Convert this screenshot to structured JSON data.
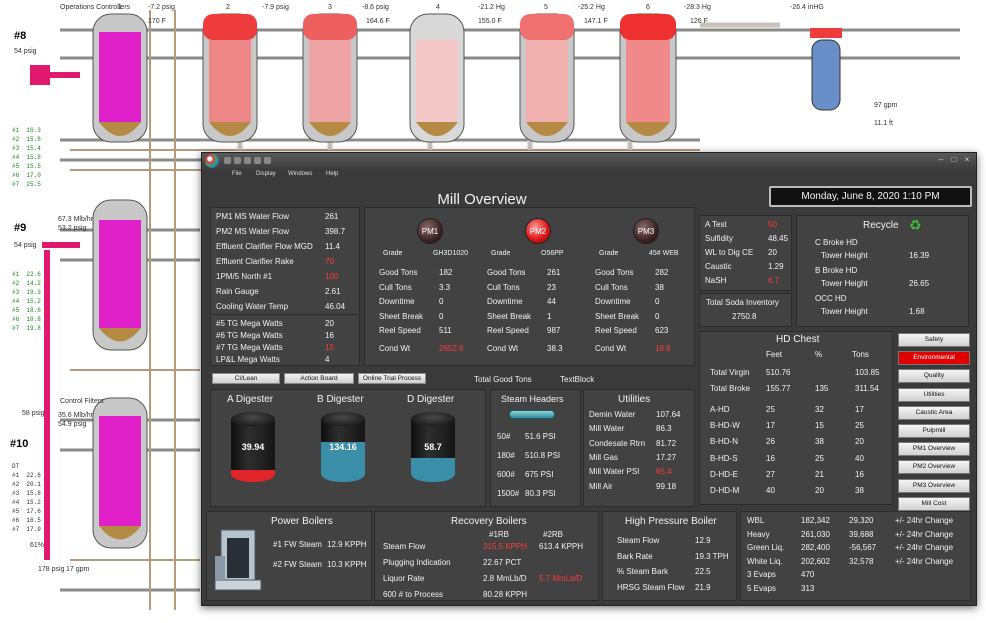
{
  "background": {
    "line_labels": [
      "#8",
      "#9",
      "#10"
    ],
    "top_readings": [
      "-7.2 psig",
      "-7.9 psig",
      "-8.6 psig",
      "-21.2 Hg",
      "-25.2 Hg",
      "-28.3 Hg",
      "-26.4 inHG"
    ],
    "top_temps": [
      "1",
      "2",
      "3",
      "4",
      "5",
      "6",
      "7"
    ],
    "misc": [
      "170 F",
      "164.6 F",
      "155.0 F",
      "147.1 F",
      "126 F",
      "97 gpm",
      "11.1 ft",
      "54 psig",
      "58 psig",
      "61%",
      "17 gpm",
      "178 psig",
      "35.6 Mlb/hr",
      "54.9 psig",
      "67.3 Mlb/hr",
      "53.2 psig",
      "Operations Controllers",
      "Control Filters"
    ],
    "stats": "#1  16.3\n#2  15.8\n#3  15.4\n#4  15.8\n#5  15.5\n#6  17.0\n#7  25.5",
    "stats2": "#1  22.6\n#2  14.2\n#3  19.3\n#4  15.2\n#5  18.6\n#6  18.8\n#7  19.8",
    "stats3": "DT\n#1  22.6\n#2  20.1\n#3  15.8\n#4  15.2\n#5  17.6\n#6  16.5\n#7  17.9"
  },
  "window": {
    "menu": [
      "File",
      "Display",
      "Windows",
      "Help"
    ],
    "title": "Mill Overview",
    "datetime": "Monday, June 8, 2020 1:10 PM"
  },
  "water": [
    {
      "label": "PM1 MS Water Flow",
      "value": "261",
      "alarm": false
    },
    {
      "label": "PM2 MS Water Flow",
      "value": "398.7",
      "alarm": false
    },
    {
      "label": "Effluent Clarifier Flow MGD",
      "value": "11.4",
      "alarm": false
    },
    {
      "label": "Effluent Clarifier Rake",
      "value": "70",
      "alarm": true
    },
    {
      "label": "1PM/5 North #1",
      "value": "100",
      "alarm": true
    },
    {
      "label": "Rain Gauge",
      "value": "2.61",
      "alarm": false
    },
    {
      "label": "Cooling Water Temp",
      "value": "46.04",
      "alarm": false
    }
  ],
  "power": [
    {
      "label": "#5 TG Mega Watts",
      "value": "20",
      "alarm": false
    },
    {
      "label": "#6 TG Mega Watts",
      "value": "16",
      "alarm": false
    },
    {
      "label": "#7 TG Mega Watts",
      "value": "15",
      "alarm": true
    },
    {
      "label": "LP&L Mega Watts",
      "value": "4",
      "alarm": false
    }
  ],
  "pm": [
    {
      "name": "PM1",
      "grade_label": "Grade",
      "grade": "GH3D1020",
      "good": "182",
      "cull": "3.3",
      "downtime": "0",
      "sheet_break": "0",
      "reel_speed": "511",
      "cond_wt": "2652.6",
      "cond_alarm": true
    },
    {
      "name": "PM2",
      "grade_label": "Grade",
      "grade": "O56PP",
      "good": "261",
      "cull": "23",
      "downtime": "44",
      "sheet_break": "1",
      "reel_speed": "987",
      "cond_wt": "38.3",
      "cond_alarm": false
    },
    {
      "name": "PM3",
      "grade_label": "Grade",
      "grade": "45# WEB",
      "good": "282",
      "cull": "38",
      "downtime": "0",
      "sheet_break": "0",
      "reel_speed": "623",
      "cond_wt": "18.8",
      "cond_alarm": true
    }
  ],
  "pm_labels": {
    "good": "Good Tons",
    "cull": "Cull Tons",
    "downtime": "Downtime",
    "sheet_break": "Sheet Break",
    "reel_speed": "Reel Speed",
    "cond_wt": "Cond Wt"
  },
  "chem": [
    {
      "label": "A Test",
      "value": "50",
      "alarm": true
    },
    {
      "label": "Sulfidity",
      "value": "48.45",
      "alarm": false
    },
    {
      "label": "WL to Dig CE",
      "value": "20",
      "alarm": false
    },
    {
      "label": "Caustic",
      "value": "1.29",
      "alarm": false
    },
    {
      "label": "NaSH",
      "value": "6.7",
      "alarm": true
    }
  ],
  "soda": {
    "label": "Total Soda Inventory",
    "value": "2750.8"
  },
  "recycle": {
    "title": "Recycle",
    "items": [
      {
        "name": "C Broke HD",
        "sub": "Tower Height",
        "value": "16.39"
      },
      {
        "name": "B Broke HD",
        "sub": "Tower Height",
        "value": "26.65"
      },
      {
        "name": "OCC HD",
        "sub": "Tower Height",
        "value": "1.68"
      }
    ]
  },
  "hd_chest": {
    "title": "HD Chest",
    "cols": [
      "Feet",
      "%",
      "Tons"
    ],
    "rows": [
      {
        "name": "Total Virgin",
        "feet": "510.76",
        "pct": "",
        "tons": "103.85"
      },
      {
        "name": "Total Broke",
        "feet": "155.77",
        "pct": "135",
        "tons": "311.54"
      },
      {
        "name": "A-HD",
        "feet": "25",
        "pct": "32",
        "tons": "17"
      },
      {
        "name": "B-HD-W",
        "feet": "17",
        "pct": "15",
        "tons": "25"
      },
      {
        "name": "B-HD-N",
        "feet": "26",
        "pct": "38",
        "tons": "20"
      },
      {
        "name": "B-HD-S",
        "feet": "16",
        "pct": "25",
        "tons": "40"
      },
      {
        "name": "D-HD-E",
        "feet": "27",
        "pct": "21",
        "tons": "16"
      },
      {
        "name": "D-HD-M",
        "feet": "40",
        "pct": "20",
        "tons": "38"
      }
    ]
  },
  "nav_buttons": [
    {
      "label": "Safety",
      "active": false
    },
    {
      "label": "Environmental",
      "active": true
    },
    {
      "label": "Quality",
      "active": false
    },
    {
      "label": "Utilities",
      "active": false
    },
    {
      "label": "Caustic Area",
      "active": false
    },
    {
      "label": "Pulpmill",
      "active": false
    },
    {
      "label": "PM1 Overview",
      "active": false
    },
    {
      "label": "PM2 Overview",
      "active": false
    },
    {
      "label": "PM3 Overview",
      "active": false
    },
    {
      "label": "Mill Cost",
      "active": false
    }
  ],
  "toolbar": {
    "btn1": "CI/Lean",
    "btn2": "Action Board",
    "btn3": "Online Trial Process",
    "total_good": "Total Good Tons",
    "textblock": "TextBlock"
  },
  "digesters": [
    {
      "name": "A Digester",
      "value": "39.94",
      "level": 0.18,
      "color": "#e0262b"
    },
    {
      "name": "B Digester",
      "value": "134.16",
      "level": 0.62,
      "color": "#3a8ea8"
    },
    {
      "name": "D Digester",
      "value": "58.7",
      "level": 0.38,
      "color": "#3a8ea8"
    }
  ],
  "steam": {
    "title": "Steam Headers",
    "rows": [
      {
        "label": "50#",
        "value": "51.6 PSI"
      },
      {
        "label": "180#",
        "value": "510.8 PSI"
      },
      {
        "label": "600#",
        "value": "675 PSI"
      },
      {
        "label": "1500#",
        "value": "80.3 PSI"
      }
    ]
  },
  "utilities": {
    "title": "Utilities",
    "rows": [
      {
        "label": "Demin Water",
        "value": "107.64",
        "alarm": false
      },
      {
        "label": "Mill Water",
        "value": "86.3",
        "alarm": false
      },
      {
        "label": "Condesate Rtrn",
        "value": "81.72",
        "alarm": false
      },
      {
        "label": "Mill Gas",
        "value": "17.27",
        "alarm": false
      },
      {
        "label": "Mill Water PSI",
        "value": "65.4",
        "alarm": true
      },
      {
        "label": "Mill Air",
        "value": "99.18",
        "alarm": false
      }
    ]
  },
  "power_boilers": {
    "title": "Power Boilers",
    "rows": [
      {
        "label": "#1 FW Steam",
        "value": "12.9 KPPH"
      },
      {
        "label": "#2 FW Steam",
        "value": "10.3 KPPH"
      }
    ]
  },
  "recovery": {
    "title": "Recovery Boilers",
    "col1": "#1RB",
    "col2": "#2RB",
    "rows": [
      {
        "label": "Steam Flow",
        "v1": "315.5 KPPH",
        "v1_alarm": true,
        "v2": "613.4 KPPH",
        "v2_alarm": false
      },
      {
        "label": "Plugging Indication",
        "v1": "22.67 PCT",
        "v1_alarm": false,
        "v2": "",
        "v2_alarm": false
      },
      {
        "label": "Liquor Rate",
        "v1": "2.8 MmLb/D",
        "v1_alarm": false,
        "v2": "5.7 MmLb/D",
        "v2_alarm": true
      },
      {
        "label": "600 # to Process",
        "v1": "80.28 KPPH",
        "v1_alarm": false,
        "v2": "",
        "v2_alarm": false
      }
    ]
  },
  "hp_boiler": {
    "title": "High Pressure Boiler",
    "rows": [
      {
        "label": "Steam Flow",
        "value": "12.9"
      },
      {
        "label": "Bark Rate",
        "value": "19.3 TPH"
      },
      {
        "label": "% Steam Bark",
        "value": "22.5"
      },
      {
        "label": "HRSG Steam Flow",
        "value": "21.9"
      }
    ]
  },
  "liquor": {
    "rows": [
      {
        "label": "WBL",
        "v1": "182,342",
        "v2": "29,320",
        "note": "+/- 24hr Change"
      },
      {
        "label": "Heavy",
        "v1": "261,030",
        "v2": "39,688",
        "note": "+/- 24hr Change"
      },
      {
        "label": "Green Liq.",
        "v1": "282,400",
        "v2": "-56,567",
        "note": "+/- 24hr Change"
      },
      {
        "label": "White Liq.",
        "v1": "202,602",
        "v2": "32,578",
        "note": "+/- 24hr Change"
      },
      {
        "label": "3 Evaps",
        "v1": "470",
        "v2": "",
        "note": ""
      },
      {
        "label": "5 Evaps",
        "v1": "313",
        "v2": "",
        "note": ""
      }
    ]
  },
  "colors": {
    "alarm": "#ff3b3b",
    "panel": "#424242",
    "window": "#3a3a3a",
    "active_button": "#e00000"
  }
}
